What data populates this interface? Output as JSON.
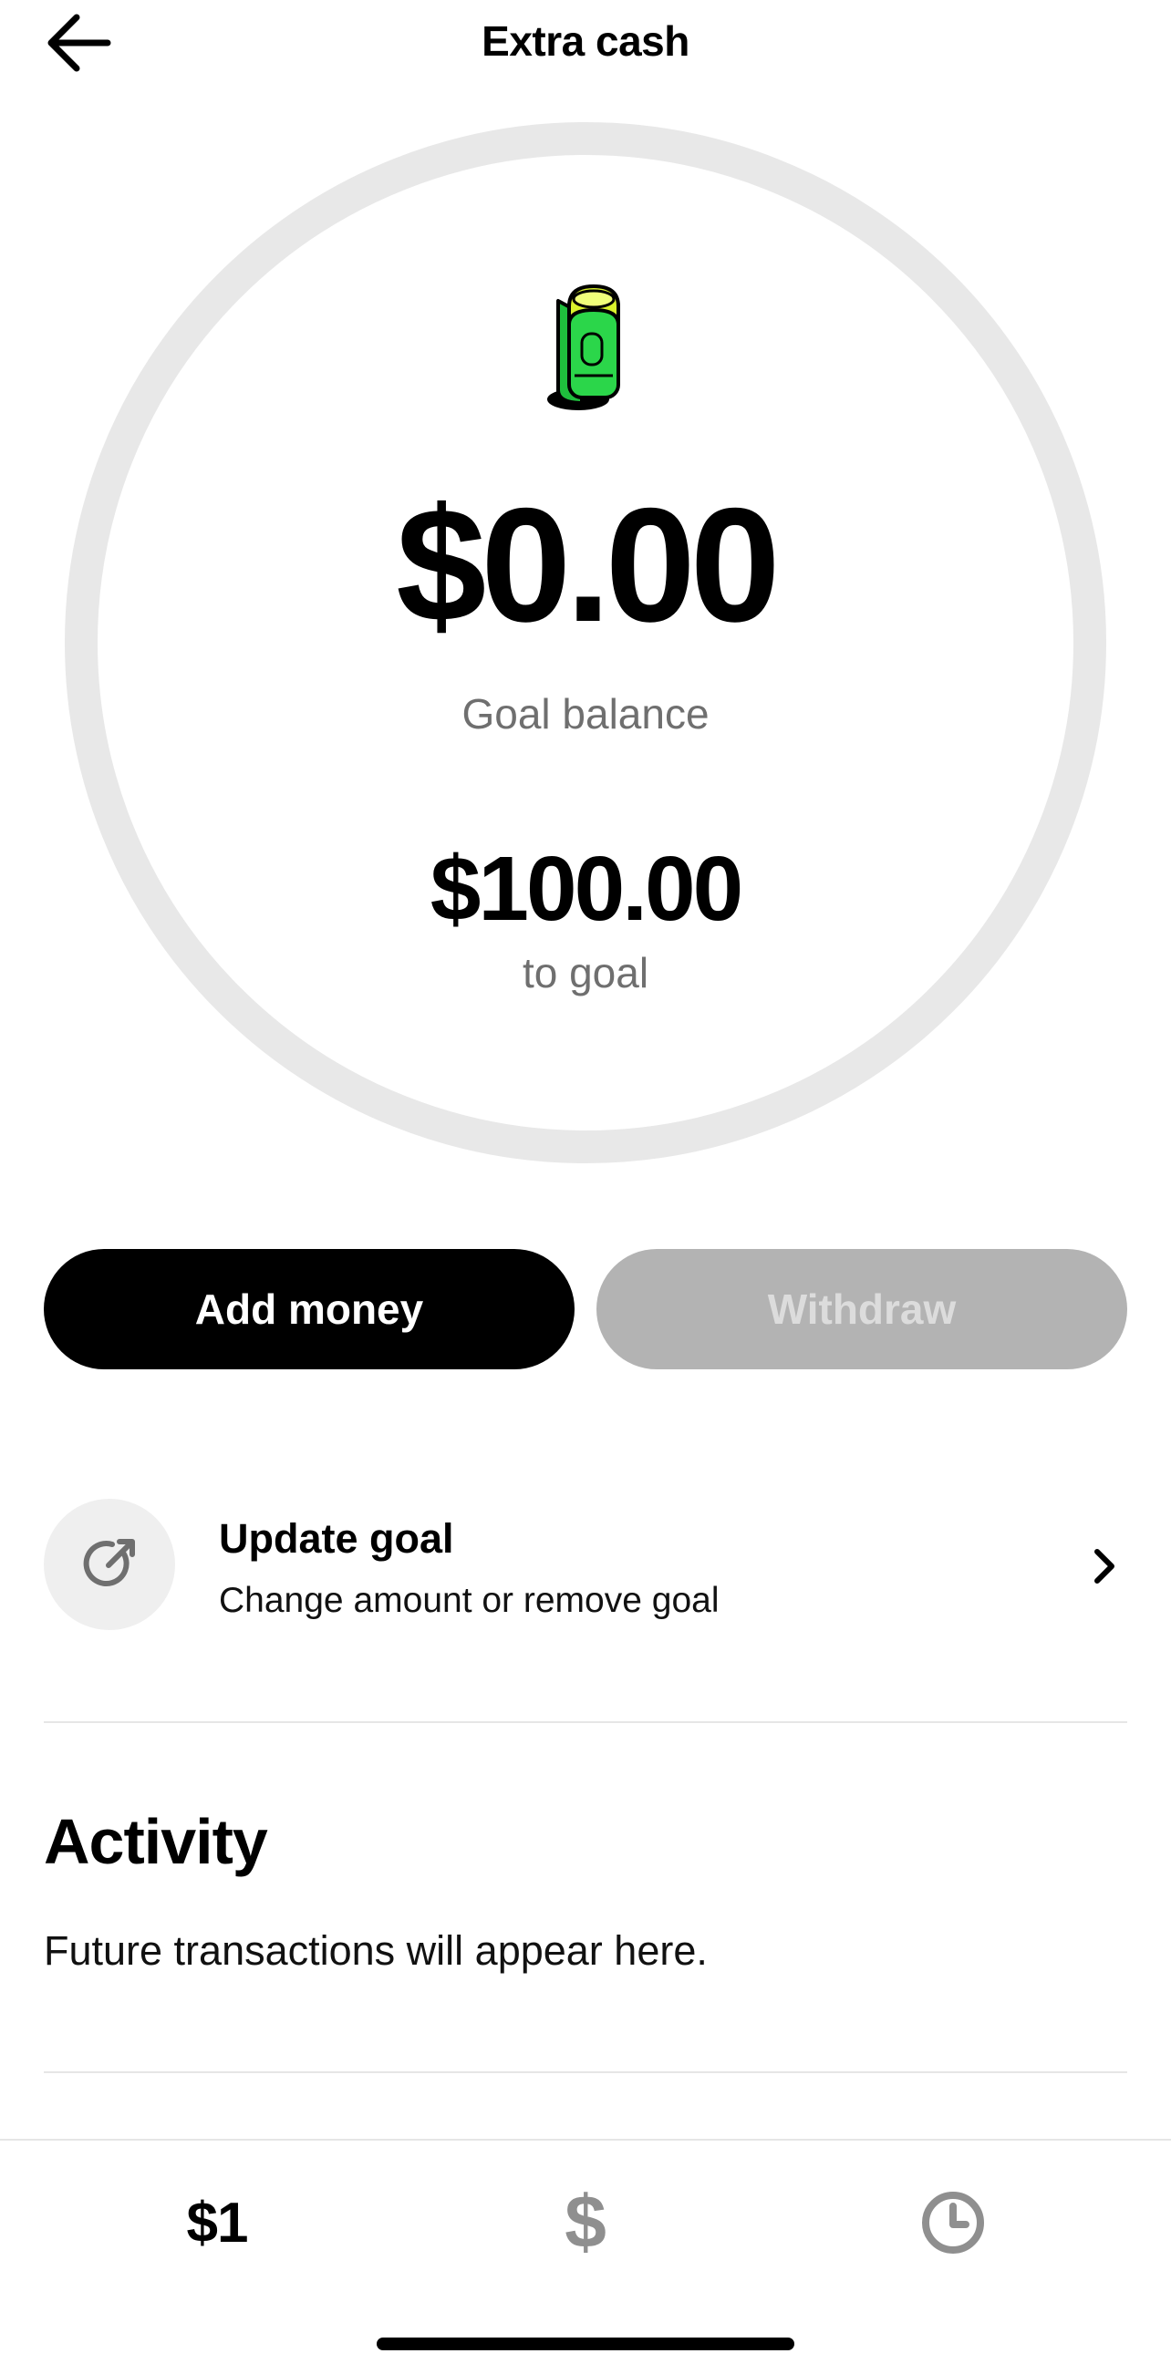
{
  "header": {
    "title": "Extra cash",
    "back_icon": "arrow-left-icon"
  },
  "goal": {
    "icon": "rolled-cash-icon",
    "balance": "$0.00",
    "balance_label": "Goal balance",
    "remaining": "$100.00",
    "remaining_label": "to goal",
    "progress_fraction": 0
  },
  "actions": {
    "add_label": "Add money",
    "withdraw_label": "Withdraw"
  },
  "update_goal": {
    "title": "Update goal",
    "subtitle": "Change amount or remove goal",
    "icon": "edit-goal-icon",
    "chevron_icon": "chevron-right-icon"
  },
  "activity": {
    "title": "Activity",
    "empty_text": "Future transactions will appear here."
  },
  "tabbar": {
    "tab1_label": "$1",
    "tab2_label": "$",
    "tab3_icon": "clock-icon"
  },
  "colors": {
    "ring": "#e8e8e8",
    "primary_button": "#000000",
    "disabled_button": "#b3b3b3",
    "cash_green": "#2bd64a",
    "cash_yellow": "#d9f22c",
    "muted_text": "#6f6f6f"
  }
}
